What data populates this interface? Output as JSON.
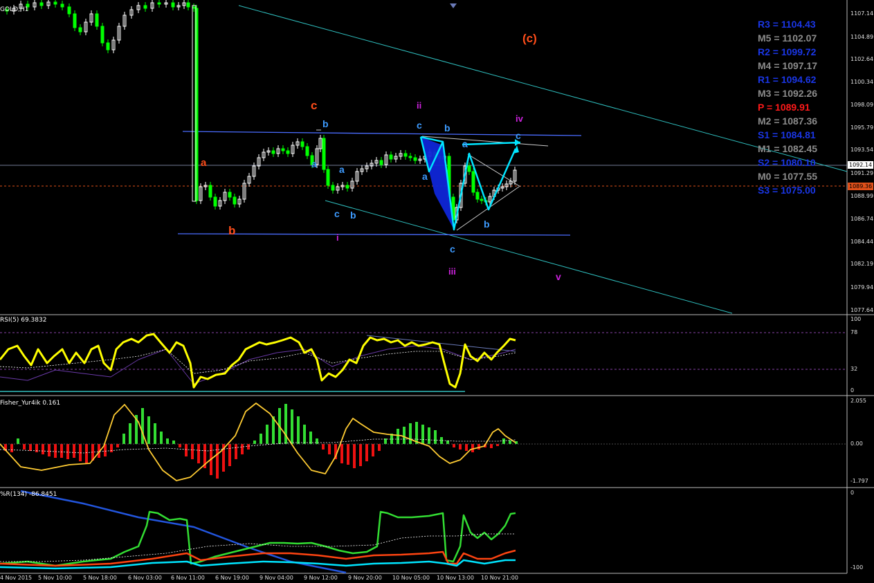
{
  "symbol_label": "GOLD,H1",
  "rsi_label": "RSI(5) 69.3832",
  "fisher_label": "Fisher_Yur4ik 0.161",
  "wpr_label": "%R(134) -86.8451",
  "colors": {
    "background": "#000000",
    "bull_candle": "#ffffff",
    "bear_candle": "#00ff00",
    "channel": "#2fbfbf",
    "blue_line": "#4a6cff",
    "cyan_pattern": "#00e5ff",
    "pattern_fill": "#0f26d8",
    "pivot_line": "#e0501a",
    "rsi_line": "#ffff00",
    "fisher_up": "#33dd33",
    "fisher_down": "#ee1111",
    "fisher_line": "#ffcc33",
    "wpr_green": "#33dd33",
    "wpr_red": "#ff4411",
    "wpr_cyan": "#00e5ff",
    "wpr_blue": "#2255dd"
  },
  "pivots": [
    {
      "text": "R3 = 1104.43",
      "color": "#1a36e6"
    },
    {
      "text": "M5 = 1102.07",
      "color": "#8c8c8c"
    },
    {
      "text": "R2 = 1099.72",
      "color": "#1a36e6"
    },
    {
      "text": "M4 = 1097.17",
      "color": "#8c8c8c"
    },
    {
      "text": "R1 = 1094.62",
      "color": "#1a36e6"
    },
    {
      "text": "M3 = 1092.26",
      "color": "#8c8c8c"
    },
    {
      "text": "P  = 1089.91",
      "color": "#ff1a1a"
    },
    {
      "text": "M2 = 1087.36",
      "color": "#8c8c8c"
    },
    {
      "text": "S1 = 1084.81",
      "color": "#1a36e6"
    },
    {
      "text": "M1 = 1082.45",
      "color": "#8c8c8c"
    },
    {
      "text": "S2 = 1080.10",
      "color": "#1a36e6"
    },
    {
      "text": "M0 = 1077.55",
      "color": "#8c8c8c"
    },
    {
      "text": "S3 = 1075.00",
      "color": "#1a36e6"
    }
  ],
  "price_axis": [
    "1107.14",
    "1104.89",
    "1102.64",
    "1100.34",
    "1098.09",
    "1095.79",
    "1093.54",
    "1091.29",
    "1088.99",
    "1086.74",
    "1084.44",
    "1082.19",
    "1079.94",
    "1077.64"
  ],
  "current_price": "1092.14",
  "pivot_price": "1089.36",
  "rsi_axis": [
    "100",
    "78",
    "32",
    "0"
  ],
  "fisher_axis": [
    "2.055",
    "0.00",
    "-1.797"
  ],
  "wpr_axis": [
    "0",
    "-100"
  ],
  "time_axis": [
    "4 Nov 2015",
    "5 Nov 10:00",
    "5 Nov 18:00",
    "6 Nov 03:00",
    "6 Nov 11:00",
    "6 Nov 19:00",
    "9 Nov 04:00",
    "9 Nov 12:00",
    "9 Nov 20:00",
    "10 Nov 05:00",
    "10 Nov 13:00",
    "10 Nov 21:00"
  ],
  "wave_labels": [
    {
      "text": "(c)",
      "color": "#ff4d1a"
    },
    {
      "text": "c",
      "color": "#ff4d1a"
    },
    {
      "text": "a",
      "color": "#ff4d1a"
    },
    {
      "text": "b",
      "color": "#ff4d1a"
    },
    {
      "text": "ii",
      "color": "#cc22dd"
    },
    {
      "text": "iv",
      "color": "#cc22dd"
    },
    {
      "text": "i",
      "color": "#cc22dd"
    },
    {
      "text": "iii",
      "color": "#cc22dd"
    },
    {
      "text": "v",
      "color": "#cc22dd"
    },
    {
      "text": "b",
      "color": "#3d9bff"
    },
    {
      "text": "a",
      "color": "#3d9bff"
    },
    {
      "text": "a",
      "color": "#3d9bff"
    },
    {
      "text": "c",
      "color": "#3d9bff"
    },
    {
      "text": "b",
      "color": "#3d9bff"
    },
    {
      "text": "c",
      "color": "#3d9bff"
    },
    {
      "text": "b",
      "color": "#3d9bff"
    },
    {
      "text": "a",
      "color": "#3d9bff"
    },
    {
      "text": "a",
      "color": "#3d9bff"
    },
    {
      "text": "c",
      "color": "#3d9bff"
    },
    {
      "text": "b",
      "color": "#3d9bff"
    },
    {
      "text": "c",
      "color": "#3d9bff"
    }
  ]
}
